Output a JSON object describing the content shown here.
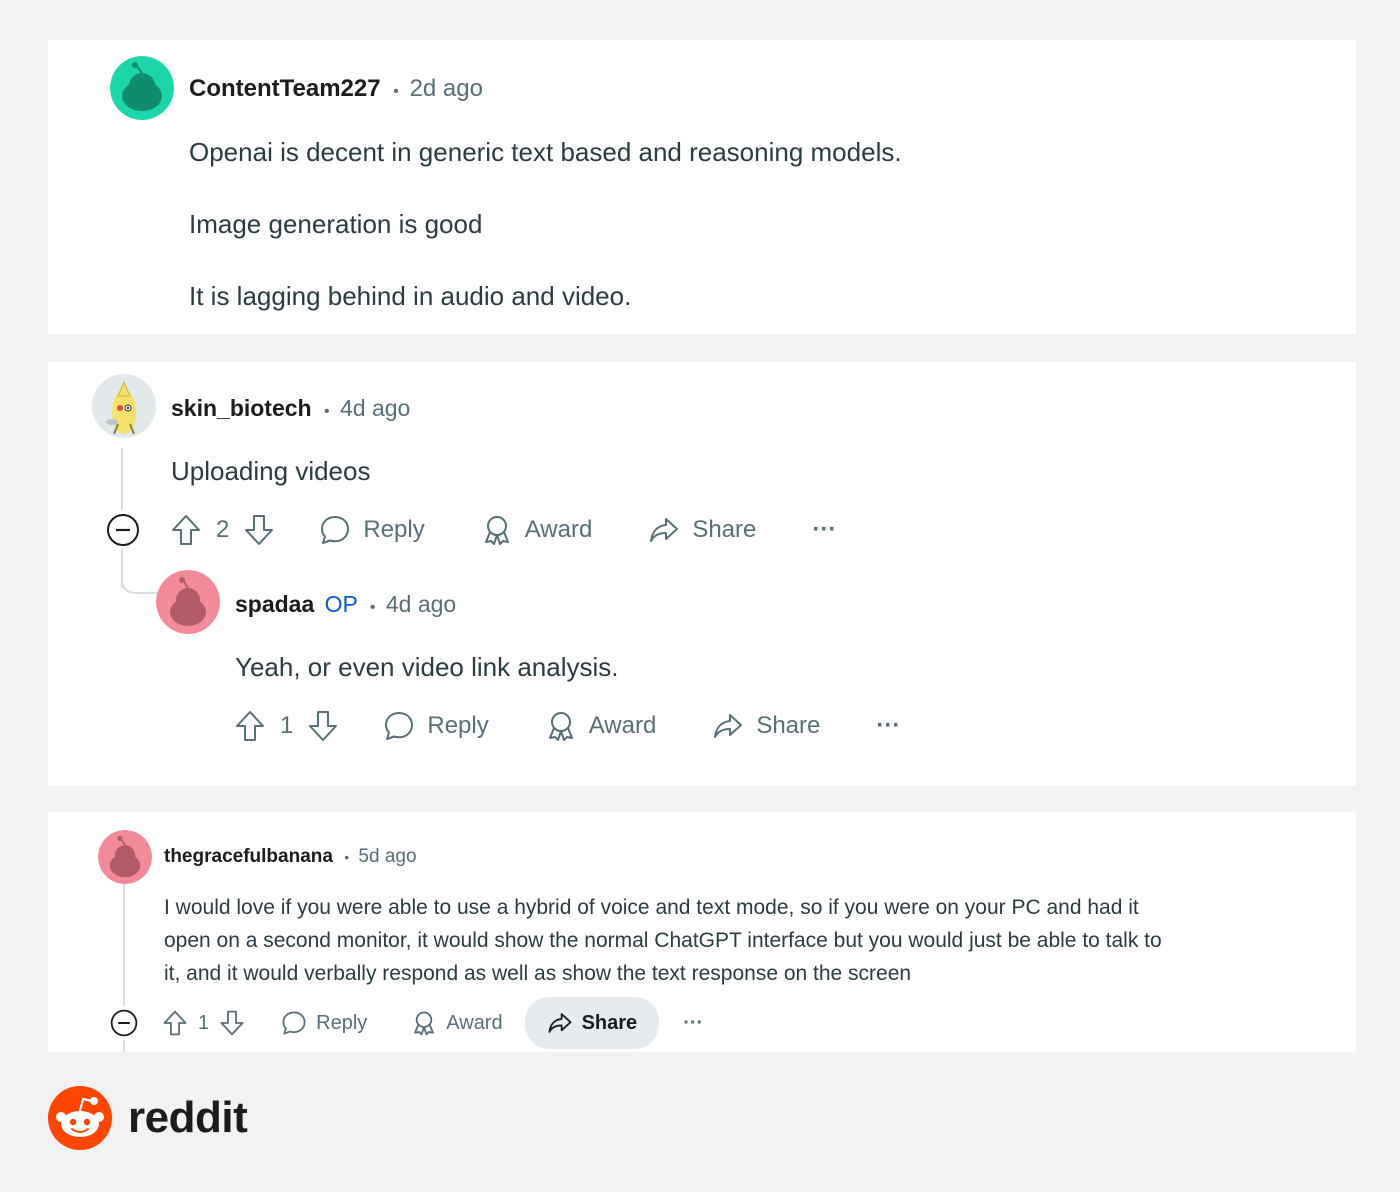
{
  "comments": [
    {
      "username": "ContentTeam227",
      "separator": "•",
      "time": "2d ago",
      "body": [
        "Openai is decent in generic text based and reasoning models.",
        "Image generation is good",
        "It is lagging behind in audio and video."
      ]
    },
    {
      "username": "skin_biotech",
      "separator": "•",
      "time": "4d ago",
      "body": [
        "Uploading videos"
      ],
      "votes": "2",
      "reply_label": "Reply",
      "award_label": "Award",
      "share_label": "Share",
      "more_label": "···"
    },
    {
      "username": "spadaa",
      "op_badge": "OP",
      "separator": "•",
      "time": "4d ago",
      "body": [
        "Yeah, or even video link analysis."
      ],
      "votes": "1",
      "reply_label": "Reply",
      "award_label": "Award",
      "share_label": "Share",
      "more_label": "···"
    },
    {
      "username": "thegracefulbanana",
      "separator": "•",
      "time": "5d ago",
      "body": [
        "I would love if you were able to use a hybrid of voice and text mode, so if you were on your PC and had it",
        "open on a second monitor, it would show the normal ChatGPT interface but you would just be able to talk to",
        "it, and it would verbally respond as well as show the text response on the screen"
      ],
      "votes": "1",
      "reply_label": "Reply",
      "award_label": "Award",
      "share_label": "Share",
      "more_label": "···"
    }
  ],
  "brand": {
    "name": "reddit",
    "color": "#ff4500"
  },
  "icons": {
    "collapse": "minus-circle-icon",
    "upvote": "arrow-up-icon",
    "downvote": "arrow-down-icon",
    "reply": "speech-bubble-icon",
    "award": "award-ribbon-icon",
    "share": "share-arrow-icon"
  },
  "colors": {
    "avatar_teal": "#1ad6a8",
    "avatar_pink": "#f28a99",
    "op_blue": "#0a5ad6",
    "share_highlight": "#e5ebee"
  }
}
